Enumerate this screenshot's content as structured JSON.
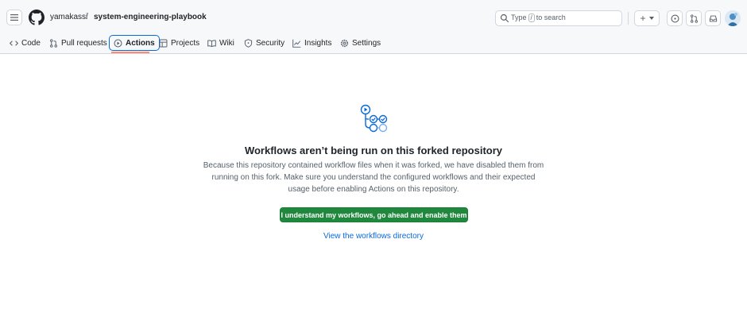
{
  "header": {
    "owner": "yamakassi",
    "separator": "/",
    "repo": "system-engineering-playbook",
    "search": {
      "before": "Type",
      "key": "/",
      "after": "to search"
    },
    "new_label": "+"
  },
  "nav": {
    "tabs": [
      {
        "label": "Code",
        "icon": "code-icon"
      },
      {
        "label": "Pull requests",
        "icon": "git-pull-request-icon"
      },
      {
        "label": "Actions",
        "icon": "play-icon",
        "active": true
      },
      {
        "label": "Projects",
        "icon": "table-icon"
      },
      {
        "label": "Wiki",
        "icon": "book-icon"
      },
      {
        "label": "Security",
        "icon": "shield-icon"
      },
      {
        "label": "Insights",
        "icon": "graph-icon"
      },
      {
        "label": "Settings",
        "icon": "gear-icon"
      }
    ]
  },
  "main": {
    "title": "Workflows aren’t being run on this forked repository",
    "description": "Because this repository contained workflow files when it was forked, we have disabled them from running on this fork. Make sure you understand the configured workflows and their expected usage before enabling Actions on this repository.",
    "enable_button": "I understand my workflows, go ahead and enable them",
    "directory_link": "View the workflows directory"
  },
  "colors": {
    "accent": "#0969da",
    "primary_button": "#1f883d",
    "active_underline": "#fd8c73"
  }
}
